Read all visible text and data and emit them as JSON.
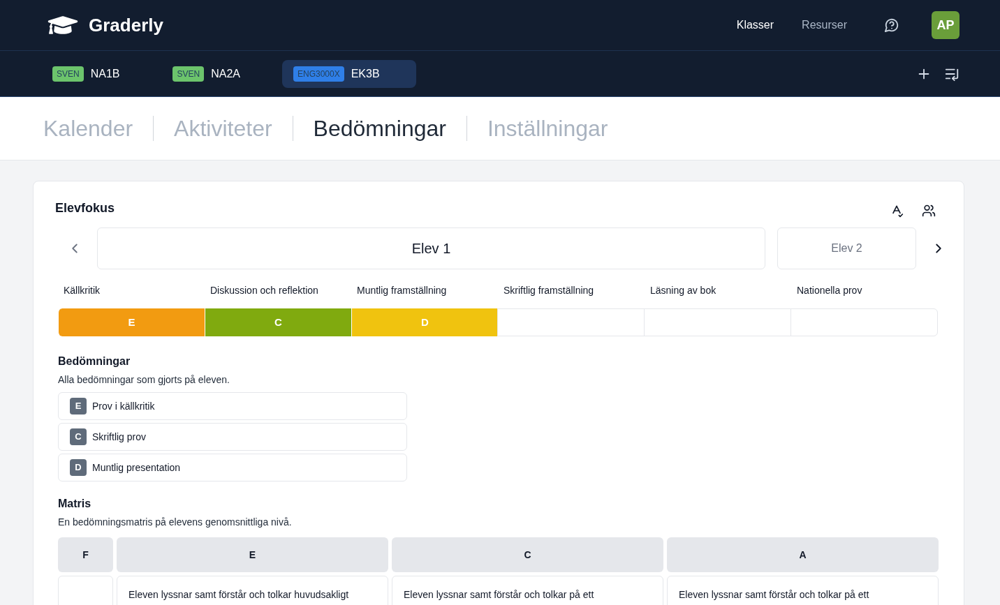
{
  "header": {
    "logo": "Graderly",
    "nav": [
      {
        "label": "Klasser",
        "selected": true
      },
      {
        "label": "Resurser",
        "selected": false
      }
    ],
    "avatar": "AP"
  },
  "class_tabs": [
    {
      "badge": "SVEN",
      "label": "NA1B",
      "color": "#6cc46c",
      "selected": false
    },
    {
      "badge": "SVEN",
      "label": "NA2A",
      "color": "#6cc46c",
      "selected": false
    },
    {
      "badge": "ENG3000X",
      "label": "EK3B",
      "color": "#2f7fe8",
      "selected": true
    }
  ],
  "page_tabs": [
    {
      "label": "Kalender",
      "selected": false
    },
    {
      "label": "Aktiviteter",
      "selected": false
    },
    {
      "label": "Bedömningar",
      "selected": true
    },
    {
      "label": "Inställningar",
      "selected": false
    }
  ],
  "student_focus": {
    "title": "Elevfokus",
    "students": [
      {
        "name": "Elev 1",
        "selected": true
      },
      {
        "name": "Elev 2",
        "selected": false
      }
    ],
    "categories": [
      {
        "label": "Källkritik",
        "grade": "E",
        "color": "#f29b11"
      },
      {
        "label": "Diskussion och reflektion",
        "grade": "C",
        "color": "#80aa0f"
      },
      {
        "label": "Muntlig framställning",
        "grade": "D",
        "color": "#f0c30f"
      },
      {
        "label": "Skriftlig framställning"
      },
      {
        "label": "Läsning av bok"
      },
      {
        "label": "Nationella prov"
      }
    ],
    "assessments": {
      "title": "Bedömningar",
      "subtitle": "Alla bedömningar som gjorts på eleven.",
      "items": [
        {
          "grade": "E",
          "label": "Prov i källkritik"
        },
        {
          "grade": "C",
          "label": "Skriftlig prov"
        },
        {
          "grade": "D",
          "label": "Muntlig presentation"
        }
      ]
    },
    "matrix": {
      "title": "Matris",
      "subtitle": "En bedömningsmatris på elevens genomsnittliga nivå.",
      "columns": [
        {
          "label": "F"
        },
        {
          "label": "E",
          "text": "Eleven lyssnar samt förstår och tolkar huvudsakligt"
        },
        {
          "label": "C",
          "text": "Eleven lyssnar samt förstår och tolkar på ett"
        },
        {
          "label": "A",
          "text": "Eleven lyssnar samt förstår och tolkar på ett"
        }
      ]
    }
  }
}
